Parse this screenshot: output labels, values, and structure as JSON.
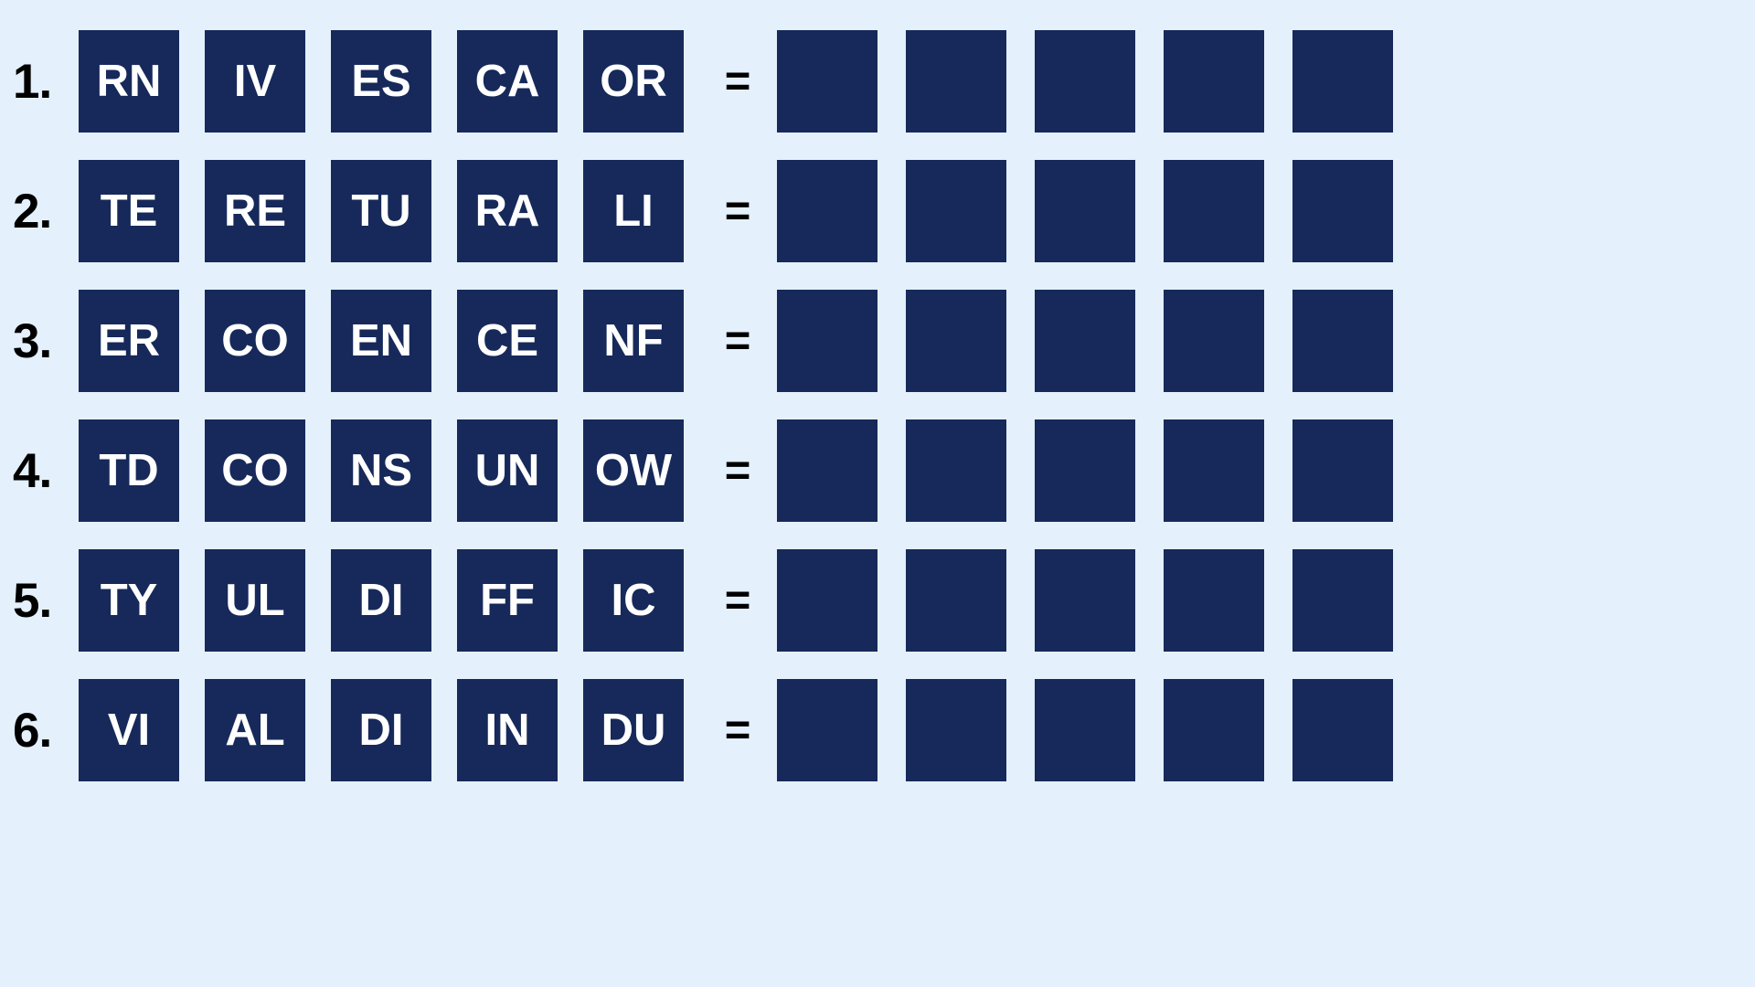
{
  "theme": {
    "background_color": "#e4f0fb",
    "tile_color": "#16295a",
    "tile_text_color": "#ffffff",
    "number_color": "#000000"
  },
  "equals_symbol": "=",
  "rows": [
    {
      "number": "1.",
      "clue_tiles": [
        "RN",
        "IV",
        "ES",
        "CA",
        "OR"
      ],
      "answer_slots": [
        "",
        "",
        "",
        "",
        ""
      ]
    },
    {
      "number": "2.",
      "clue_tiles": [
        "TE",
        "RE",
        "TU",
        "RA",
        "LI"
      ],
      "answer_slots": [
        "",
        "",
        "",
        "",
        ""
      ]
    },
    {
      "number": "3.",
      "clue_tiles": [
        "ER",
        "CO",
        "EN",
        "CE",
        "NF"
      ],
      "answer_slots": [
        "",
        "",
        "",
        "",
        ""
      ]
    },
    {
      "number": "4.",
      "clue_tiles": [
        "TD",
        "CO",
        "NS",
        "UN",
        "OW"
      ],
      "answer_slots": [
        "",
        "",
        "",
        "",
        ""
      ]
    },
    {
      "number": "5.",
      "clue_tiles": [
        "TY",
        "UL",
        "DI",
        "FF",
        "IC"
      ],
      "answer_slots": [
        "",
        "",
        "",
        "",
        ""
      ]
    },
    {
      "number": "6.",
      "clue_tiles": [
        "VI",
        "AL",
        "DI",
        "IN",
        "DU"
      ],
      "answer_slots": [
        "",
        "",
        "",
        "",
        ""
      ]
    }
  ]
}
